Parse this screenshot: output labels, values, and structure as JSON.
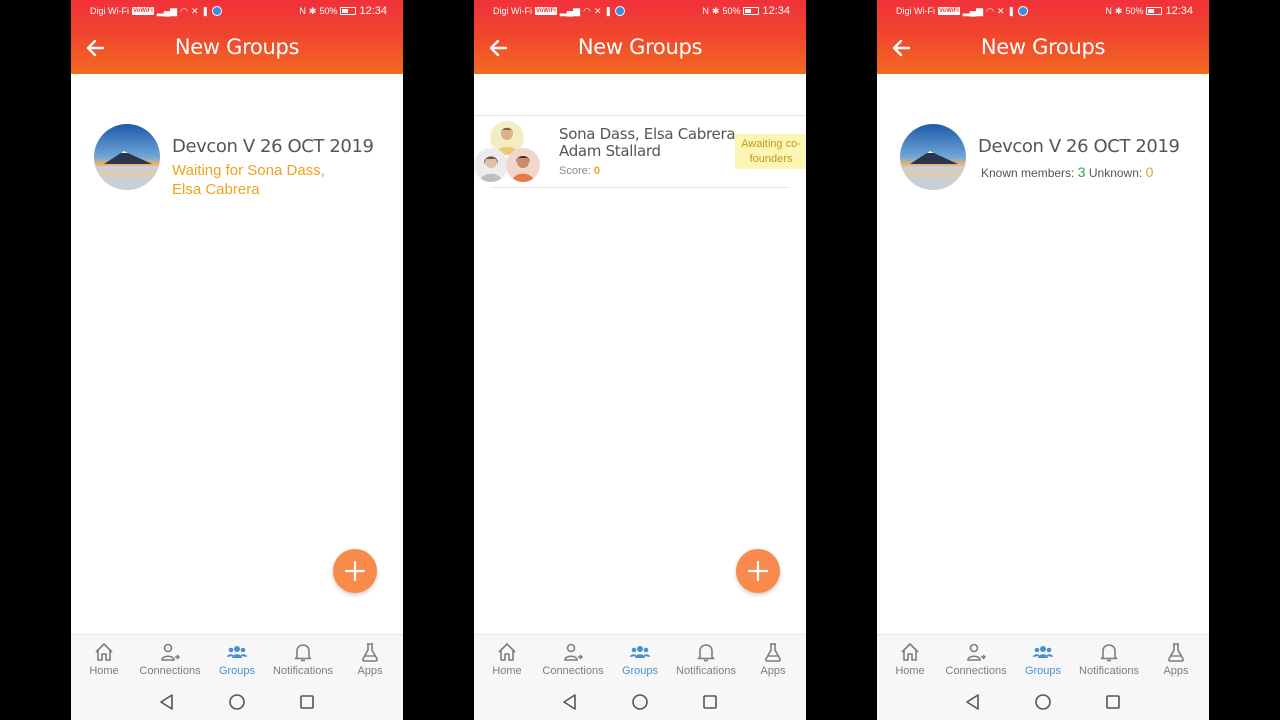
{
  "status_bar": {
    "carrier": "Digi Wi-Fi",
    "carrier_badge": "VoWiFi",
    "battery": "50%",
    "time": "12:34"
  },
  "colors": {
    "header_top": "#f1313a",
    "header_bottom": "#f36a22",
    "accent_orange": "#f0a21f",
    "fab": "#f88b4c",
    "active_nav": "#4a8fd6",
    "known_green": "#2ea24d"
  },
  "screens": [
    {
      "title": "New Groups",
      "group": {
        "name": "Devcon V 26 OCT 2019",
        "waiting_line1": "Waiting for Sona Dass,",
        "waiting_line2": "Elsa Cabrera"
      }
    },
    {
      "title": "New Groups",
      "group": {
        "names_line1": "Sona Dass, Elsa Cabrera,",
        "names_line2": "Adam Stallard",
        "score_label": "Score:",
        "score_value": "0",
        "status_line1": "Awaiting co-",
        "status_line2": "founders"
      }
    },
    {
      "title": "New Groups",
      "group": {
        "name": "Devcon V 26 OCT 2019",
        "known_label": "Known members:",
        "known_value": "3",
        "unknown_label": "Unknown:",
        "unknown_value": "0"
      }
    }
  ],
  "bottom_nav": [
    {
      "label": "Home",
      "icon": "home-icon"
    },
    {
      "label": "Connections",
      "icon": "connections-icon"
    },
    {
      "label": "Groups",
      "icon": "groups-icon",
      "active": true
    },
    {
      "label": "Notifications",
      "icon": "bell-icon"
    },
    {
      "label": "Apps",
      "icon": "flask-icon"
    }
  ],
  "fab_icon": "plus-icon",
  "system_nav": [
    "back-triangle-icon",
    "home-circle-icon",
    "recents-square-icon"
  ]
}
